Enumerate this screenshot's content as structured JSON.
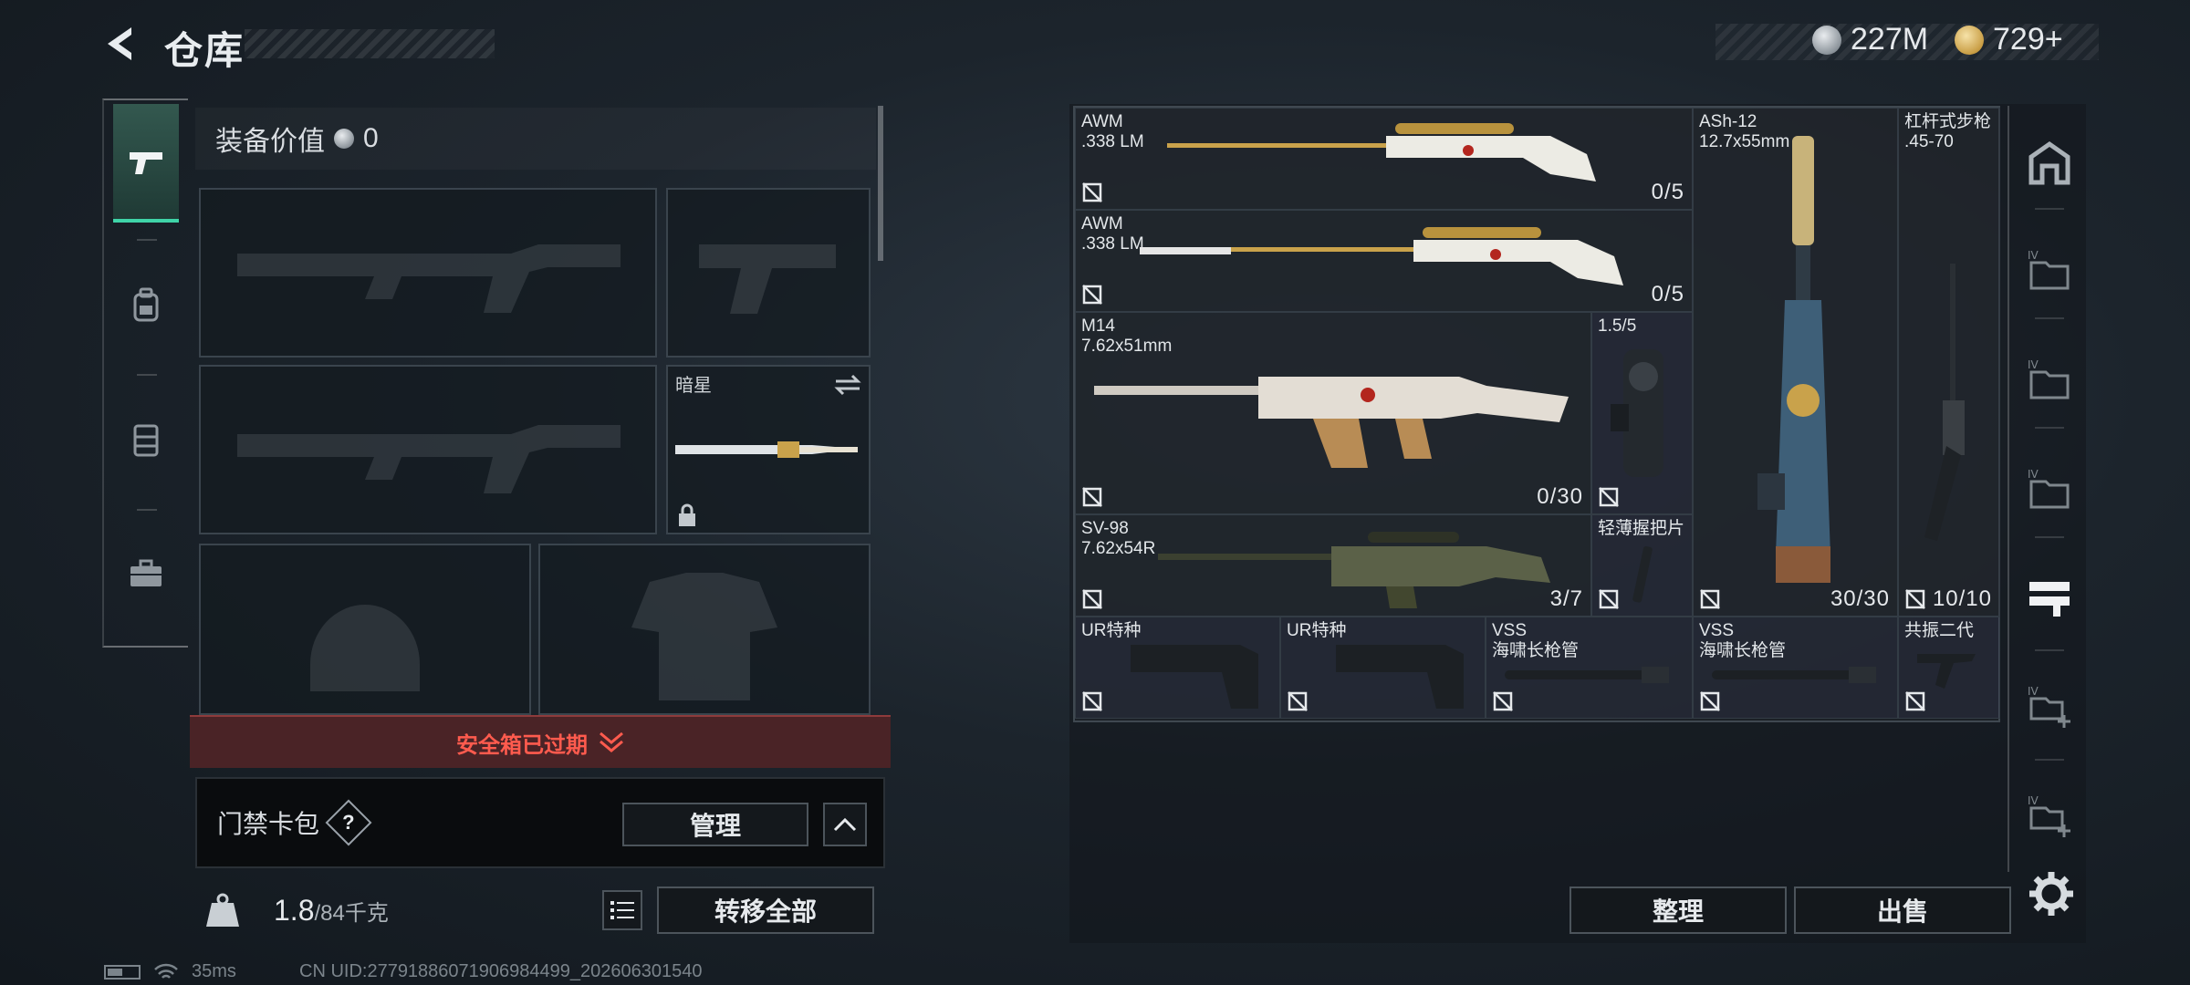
{
  "header": {
    "title": "仓库",
    "silver_amount": "227M",
    "gold_amount": "729+"
  },
  "left_tabs": [
    {
      "icon": "pistol-icon"
    },
    {
      "icon": "backpack-icon"
    },
    {
      "icon": "vest-icon"
    },
    {
      "icon": "briefcase-icon"
    }
  ],
  "equipment": {
    "value_label": "装备价值",
    "value": "0",
    "melee_slot_label": "暗星"
  },
  "safe_box": {
    "label": "安全箱已过期"
  },
  "card_pack": {
    "label": "门禁卡包",
    "help": "?",
    "manage_label": "管理"
  },
  "weight": {
    "current": "1.8",
    "max": "/84千克"
  },
  "transfer_all_label": "转移全部",
  "status_bar": {
    "ping": "35ms",
    "uid": "CN UID:27791886071906984499_202606301540"
  },
  "items": [
    {
      "name": "AWM\n.338 LM",
      "ammo": "0/5"
    },
    {
      "name": "AWM\n.338 LM",
      "ammo": "0/5"
    },
    {
      "name": "ASh-12\n12.7x55mm",
      "ammo": "30/30"
    },
    {
      "name": "杠杆式步枪\n.45-70",
      "ammo": "10/10"
    },
    {
      "name": "M14\n7.62x51mm",
      "ammo": "0/30"
    },
    {
      "name": "1.5/5",
      "ammo": ""
    },
    {
      "name": "SV-98\n7.62x54R",
      "ammo": "3/7"
    },
    {
      "name": "轻薄握把片",
      "ammo": ""
    },
    {
      "name": "UR特种",
      "ammo": ""
    },
    {
      "name": "UR特种",
      "ammo": ""
    },
    {
      "name": "VSS\n海啸长枪管",
      "ammo": ""
    },
    {
      "name": "VSS\n海啸长枪管",
      "ammo": ""
    },
    {
      "name": "共振二代",
      "ammo": ""
    }
  ],
  "right_actions": {
    "sort_label": "整理",
    "sell_label": "出售"
  },
  "colors": {
    "accent_green": "#3fd4a8",
    "warning_red": "#ff5b4e"
  }
}
